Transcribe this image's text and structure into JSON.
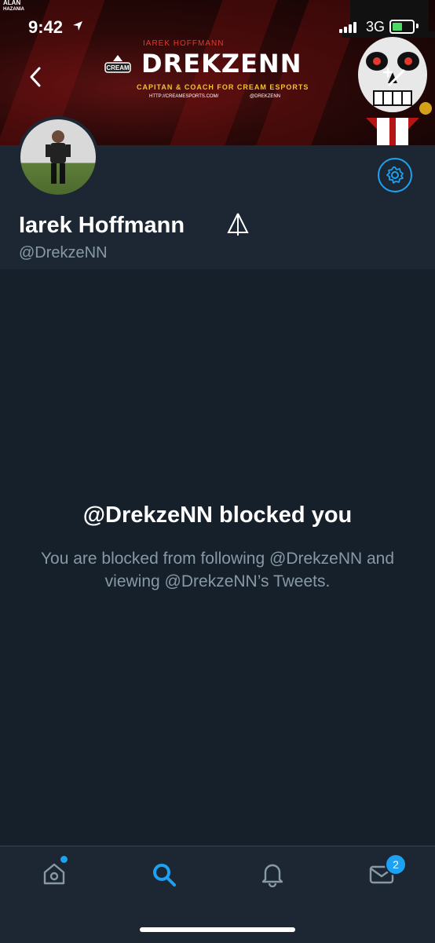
{
  "status_bar": {
    "time": "9:42",
    "network": "3G",
    "corner_logo": [
      "ALAN",
      "HAZANIA"
    ]
  },
  "banner": {
    "subtitle": "IAREK HOFFMANN",
    "title": "DREKZENN",
    "tagline": "CAPITAN & COACH FOR CREAM ESPORTS",
    "url": "HTTP://CREAMESPORTS.COM/",
    "social_handle": "@DREKZENN",
    "team_logo_text": "CREAM"
  },
  "profile": {
    "name": "Iarek Hoffmann",
    "handle": "@DrekzeNN"
  },
  "blocked": {
    "title": "@DrekzeNN blocked you",
    "description": "You are blocked from following @DrekzeNN and viewing @DrekzeNN’s Tweets."
  },
  "tabbar": {
    "messages_badge": "2",
    "icons": [
      "home-icon",
      "search-icon",
      "notifications-icon",
      "messages-icon"
    ]
  },
  "colors": {
    "accent": "#1da1f2",
    "background": "#15202b",
    "surface": "#1c2733",
    "secondary_text": "#8899a6",
    "battery": "#4cd964"
  }
}
